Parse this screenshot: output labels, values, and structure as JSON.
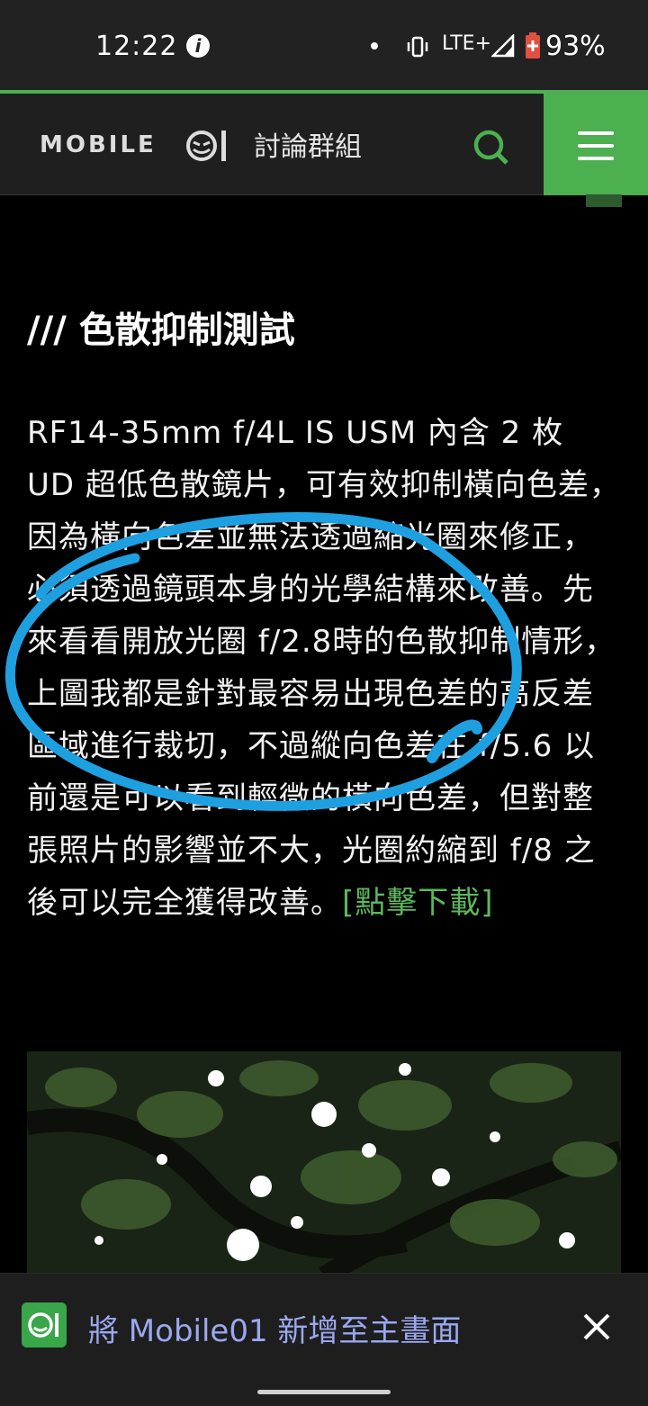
{
  "status_bar": {
    "time": "12:22",
    "info_badge": "i",
    "network": "LTE+",
    "battery_pct": "93%",
    "icons": [
      "info-icon",
      "dot-icon",
      "vibrate-icon",
      "signal-icon",
      "battery-icon"
    ]
  },
  "header": {
    "logo_text": "MOBILE",
    "forum_label": "討論群組",
    "search_icon": "search-icon",
    "menu_icon": "hamburger-icon",
    "accent": "#4caf50"
  },
  "article": {
    "heading": "/// 色散抑制測試",
    "paragraph": "RF14-35mm f/4L IS USM 內含 2 枚 UD 超低色散鏡片，可有效抑制橫向色差， 因為橫向色差並無法透過縮光圈來修正，必須透過鏡頭本身的光學結構來改善。先來看看開放光圈 f/2.8時的色散抑制情形，上圖我都是針對最容易出現色差的高反差區域進行裁切，不過縱向色差在 f/5.6 以前還是可以看到輕微的橫向色差，但對整張照片的影響並不大，光圈約縮到 f/8 之後可以完全獲得改善。",
    "download_link": "[點擊下載]",
    "link_color": "#5cb85c",
    "annotation_color": "#1ea0e0"
  },
  "banner": {
    "text": "將 Mobile01 新增至主畫面",
    "close_icon": "close-icon",
    "text_color": "#9ba8f0"
  }
}
